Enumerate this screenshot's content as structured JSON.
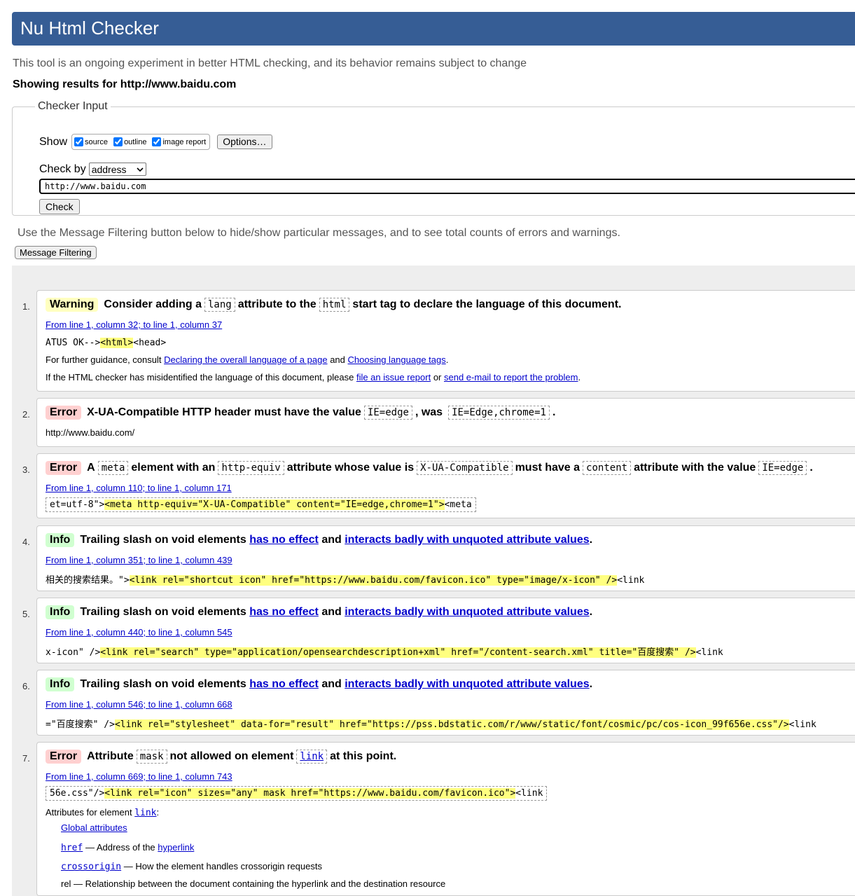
{
  "header": {
    "title": "Nu Html Checker"
  },
  "intro": "This tool is an ongoing experiment in better HTML checking, and its behavior remains subject to change",
  "showing": "Showing results for http://www.baidu.com",
  "checker": {
    "legend": "Checker Input",
    "show_label": "Show",
    "show_options": [
      "source",
      "outline",
      "image report"
    ],
    "options_button": "Options…",
    "check_by_label": "Check by",
    "check_by_value": "address",
    "url_value": "http://www.baidu.com",
    "check_button": "Check"
  },
  "filter_note": "Use the Message Filtering button below to hide/show particular messages, and to see total counts of errors and warnings.",
  "filter_button": "Message Filtering",
  "messages": {
    "m1": {
      "num": "1.",
      "badge": "Warning",
      "t1": "Consider adding a",
      "c1": "lang",
      "t2": "attribute to the",
      "c2": "html",
      "t3": "start tag to declare the language of this document.",
      "loc": "From line 1, column 32; to line 1, column 37",
      "ex_pre": "ATUS OK-->",
      "ex_hl": "<html>",
      "ex_post": "<head>",
      "g1": "For further guidance, consult",
      "g1_link1": "Declaring the overall language of a page",
      "g1_and": "and",
      "g1_link2": "Choosing language tags",
      "g1_end": ".",
      "g2": "If the HTML checker has misidentified the language of this document, please",
      "g2_link1": "file an issue report",
      "g2_or": "or",
      "g2_link2": "send e-mail to report the problem",
      "g2_end": "."
    },
    "m2": {
      "num": "2.",
      "badge": "Error",
      "t1": "X-UA-Compatible HTTP header must have the value",
      "c1": "IE=edge",
      "t2": ", was",
      "c2": "IE=Edge,chrome=1",
      "t3": ".",
      "url": "http://www.baidu.com/"
    },
    "m3": {
      "num": "3.",
      "badge": "Error",
      "t1": "A",
      "c1": "meta",
      "t2": "element with an",
      "c2": "http-equiv",
      "t3": "attribute whose value is",
      "c3": "X-UA-Compatible",
      "t4": "must have a",
      "c4": "content",
      "t5": "attribute with the value",
      "c5": "IE=edge",
      "t6": ".",
      "loc": "From line 1, column 110; to line 1, column 171",
      "ex_pre": "et=utf-8\">",
      "ex_hl": "<meta http-equiv=\"X-UA-Compatible\" content=\"IE=edge,chrome=1\">",
      "ex_post": "<meta"
    },
    "m4": {
      "num": "4.",
      "badge": "Info",
      "t1": "Trailing slash on void elements",
      "link1": "has no effect",
      "t2": "and",
      "link2": "interacts badly with unquoted attribute values",
      "t3": ".",
      "loc": "From line 1, column 351; to line 1, column 439",
      "ex_pre": "相关的搜索结果。\">",
      "ex_hl": "<link rel=\"shortcut icon\" href=\"https://www.baidu.com/favicon.ico\" type=\"image/x-icon\" />",
      "ex_post": "<link"
    },
    "m5": {
      "num": "5.",
      "badge": "Info",
      "t1": "Trailing slash on void elements",
      "link1": "has no effect",
      "t2": "and",
      "link2": "interacts badly with unquoted attribute values",
      "t3": ".",
      "loc": "From line 1, column 440; to line 1, column 545",
      "ex_pre": "x-icon\" />",
      "ex_hl": "<link rel=\"search\" type=\"application/opensearchdescription+xml\" href=\"/content-search.xml\" title=\"百度搜索\" />",
      "ex_post": "<link"
    },
    "m6": {
      "num": "6.",
      "badge": "Info",
      "t1": "Trailing slash on void elements",
      "link1": "has no effect",
      "t2": "and",
      "link2": "interacts badly with unquoted attribute values",
      "t3": ".",
      "loc": "From line 1, column 546; to line 1, column 668",
      "ex_pre": "=\"百度搜索\" />",
      "ex_hl": "<link rel=\"stylesheet\" data-for=\"result\" href=\"https://pss.bdstatic.com/r/www/static/font/cosmic/pc/cos-icon_99f656e.css\"/>",
      "ex_post": "<link"
    },
    "m7": {
      "num": "7.",
      "badge": "Error",
      "t1": "Attribute",
      "c1": "mask",
      "t2": "not allowed on element",
      "c2": "link",
      "t3": "at this point.",
      "loc": "From line 1, column 669; to line 1, column 743",
      "ex_pre": "56e.css\"/>",
      "ex_hl": "<link rel=\"icon\" sizes=\"any\" mask href=\"https://www.baidu.com/favicon.ico\">",
      "ex_post": "<link",
      "attrs_label": "Attributes for element",
      "attrs_link": "link",
      "attrs_colon": ":",
      "global": "Global attributes",
      "href_code": "href",
      "href_desc": "— Address of the",
      "href_link": "hyperlink",
      "cross_code": "crossorigin",
      "cross_desc": "— How the element handles crossorigin requests",
      "rel_partial": "rel — Relationship between the document containing the hyperlink and the destination resource"
    }
  }
}
